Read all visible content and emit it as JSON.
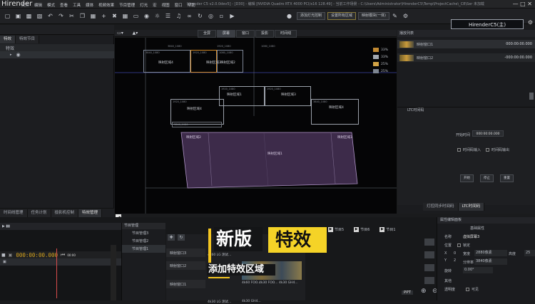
{
  "app": {
    "name": "Hirender",
    "title_info": "Hirender C5 v2.0.0dev5] - [D30] - 编辑 [NVIDIA Quadro RTX 4000 PCI/x16 128.49] - 当前工作场景 - C:\\Users\\Administrator\\HirenderC5\\Temp\\ProjectCache\\_C8\\Ser 未加载",
    "brand": "HirenderC5(主)"
  },
  "menu": [
    "文件",
    "编辑",
    "模式",
    "查看",
    "工具",
    "媒体",
    "视频效果",
    "节目管理",
    "灯光",
    "宏",
    "视图",
    "窗口",
    "帮助"
  ],
  "toolbar": {
    "btn_a": "添加灯光控制",
    "btn_b": "设置所有区域",
    "btn_c": "映射模块(一体)"
  },
  "canvas_modes": [
    "全屏",
    "屏幕",
    "窗口",
    "投影",
    "时间线"
  ],
  "left": {
    "tabs": [
      "特效",
      "特效节目"
    ],
    "tree_label": "特效",
    "bottom_tabs": [
      "时间线管理",
      "任务计划",
      "投影机控制",
      "特效管理"
    ]
  },
  "canvas": {
    "pct": [
      "33%",
      "33%",
      "25%",
      "25%"
    ],
    "top_labels": [
      "3840_1080",
      "1920_1080",
      "1080_1080"
    ],
    "boxes": [
      {
        "name": "映射区域4",
        "tag": "3840_1080"
      },
      {
        "name": "映射区域3",
        "tag": "1920_1080"
      },
      {
        "name": "映射区域2",
        "tag": "1080_1080"
      },
      {
        "name": "映射区域1",
        "tag": "1920_1080"
      },
      {
        "name": "映射区域3",
        "tag": "1920_1080"
      },
      {
        "name": "映射区域4",
        "tag": "1920_1080"
      },
      {
        "name": "映射区域4",
        "tag": "3840_1080"
      },
      {
        "name": "映射区域5",
        "tag": "3840_1080"
      }
    ],
    "purple_labels": [
      "映射区域2",
      "映射区域1",
      "映射区域3"
    ]
  },
  "right": {
    "header": "播放列表",
    "tracks": [
      {
        "name": "映射窗口1",
        "time": "000:00:00.000"
      },
      {
        "name": "映射窗口2",
        "time": "-000:00:00.000"
      }
    ],
    "ltc": {
      "header": "LTC时间码",
      "start_label": "开始时间",
      "start_time": "000:00:00.000",
      "check_a": "时间码输入",
      "check_b": "时间码输出",
      "btn_start": "开始",
      "btn_stop": "停止",
      "btn_reset": "重置"
    },
    "tabs": [
      "灯控同步时间码",
      "LTC时间码"
    ]
  },
  "bottom": {
    "timecode": "000:00:00.000",
    "timecode_small": "00:00",
    "program_header": "节目管理",
    "programs": [
      "节目管理3",
      "节目管理2",
      "节目管理1"
    ],
    "layers": [
      "映射窗口3",
      "映射窗口2",
      "映射窗口1"
    ],
    "layer_labels": [
      "4k60 FOO...",
      "4k30 FOO...",
      "4k30 GH4...",
      "4k30 GH4..."
    ],
    "layer_top": "4k60 LG 测试...",
    "layer_bottom": "4k30 LG 测试...",
    "progs": [
      "节目5",
      "节目6",
      "节目1"
    ],
    "ppt": "PPT",
    "overlay_title_a": "新版",
    "overlay_title_b": "特效",
    "overlay_subtitle": "添加特效区域"
  },
  "props": {
    "header": "属性编辑面板",
    "title": "基础属性",
    "name_label": "名称",
    "name_value": "虚拟屏幕3",
    "pos_label": "位置",
    "lock_label": "锁定",
    "x_label": "X",
    "x_value": "0",
    "y_label": "Y",
    "y_value": "2",
    "w_label": "宽度",
    "w_value": "2880像素",
    "h_label": "高度",
    "h_value": "3840像素",
    "size_label": "分辨率",
    "rot_label": "旋转",
    "rot_value": "0.00°",
    "extra_num": "25",
    "extra_label": "其他",
    "opacity_label": "透明度",
    "vis_label": "可见"
  }
}
